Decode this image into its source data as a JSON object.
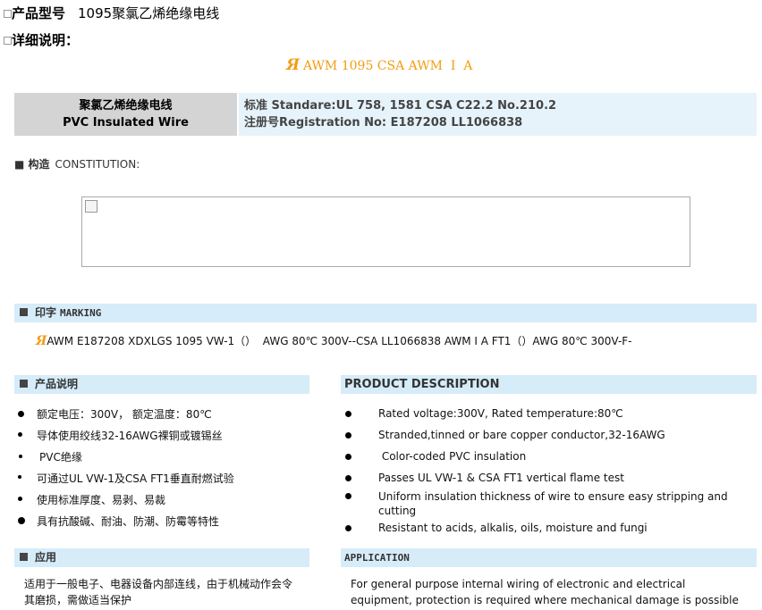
{
  "header": {
    "product_model_label": "产品型号",
    "product_model_value": "1095聚氯乙烯绝缘电线",
    "details_label": "详细说明：",
    "ul_logo": "Я",
    "awm_line": "AWM 1095 CSA AWM  Ⅰ  A"
  },
  "spec": {
    "name_cn": "聚氯乙烯绝缘电线",
    "name_en": "PVC Insulated Wire",
    "standard": "标准  Standare:UL 758, 1581 CSA C22.2 No.210.2",
    "registration": "注册号Registration No: E187208 LL1066838"
  },
  "construction": {
    "label_cn": "■ 构造",
    "label_en": "CONSTITUTION:"
  },
  "marking": {
    "label_cn": "印字",
    "label_en": "MARKING",
    "ul_logo": "Я",
    "text": "AWM E187208 XDXLGS 1095 VW-1（）  AWG 80℃ 300V--CSA LL1066838 AWM I A FT1（）AWG 80℃ 300V-F-"
  },
  "product_cn": {
    "title": "产品说明",
    "items": [
      "额定电压：300V，  额定温度：80℃",
      "导体使用绞线32-16AWG裸铜或镀锡丝",
      "PVC绝缘",
      "可通过UL VW-1及CSA FT1垂直耐燃试验",
      "使用标准厚度、易剥、易裁",
      "具有抗酸碱、耐油、防潮、防霉等特性"
    ]
  },
  "product_en": {
    "title": "PRODUCT DESCRIPTION",
    "items": [
      "Rated voltage:300V, Rated temperature:80℃",
      "Stranded,tinned or bare copper conductor,32-16AWG",
      " Color-coded PVC insulation",
      "Passes UL VW-1 & CSA FT1 vertical flame test",
      "Uniform insulation thickness of wire to ensure easy stripping and cutting",
      "Resistant to acids, alkalis, oils, moisture and fungi"
    ]
  },
  "application_cn": {
    "title": "应用",
    "text": "适用于一般电子、电器设备内部连线，由于机械动作会令其磨损，需做适当保护"
  },
  "application_en": {
    "title": "APPLICATION",
    "text": "For general purpose internal wiring of electronic and electrical equipment, protection is required where mechanical damage is possible"
  }
}
